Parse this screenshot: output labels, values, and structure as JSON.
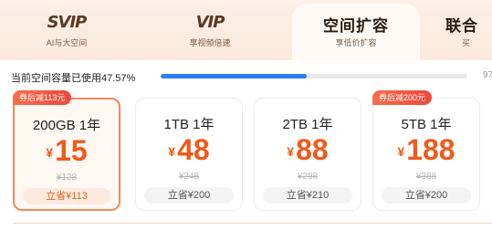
{
  "tabs": [
    {
      "title": "SVIP",
      "subtitle": "AI与大空间"
    },
    {
      "title": "VIP",
      "subtitle": "享视频倍速"
    },
    {
      "title": "空间扩容",
      "subtitle": "享低价扩容"
    },
    {
      "title": "联合",
      "subtitle": "买"
    }
  ],
  "usage": {
    "text": "当前空间容量已使用47.57%",
    "percent": 47.57,
    "capacity_partial": "97"
  },
  "colors": {
    "accent": "#ef5a1a",
    "progress": "#2f7cf6",
    "badge": "#f1473a"
  },
  "cards": [
    {
      "plan": "200GB 1年",
      "currency": "¥",
      "price": "15",
      "original": "¥128",
      "save": "立省¥113",
      "badge": "券后减113元"
    },
    {
      "plan": "1TB 1年",
      "currency": "¥",
      "price": "48",
      "original": "¥248",
      "save": "立省¥200"
    },
    {
      "plan": "2TB 1年",
      "currency": "¥",
      "price": "88",
      "original": "¥298",
      "save": "立省¥210"
    },
    {
      "plan": "5TB 1年",
      "currency": "¥",
      "price": "188",
      "original": "¥388",
      "save": "立省¥200",
      "badge": "券后减200元"
    }
  ]
}
